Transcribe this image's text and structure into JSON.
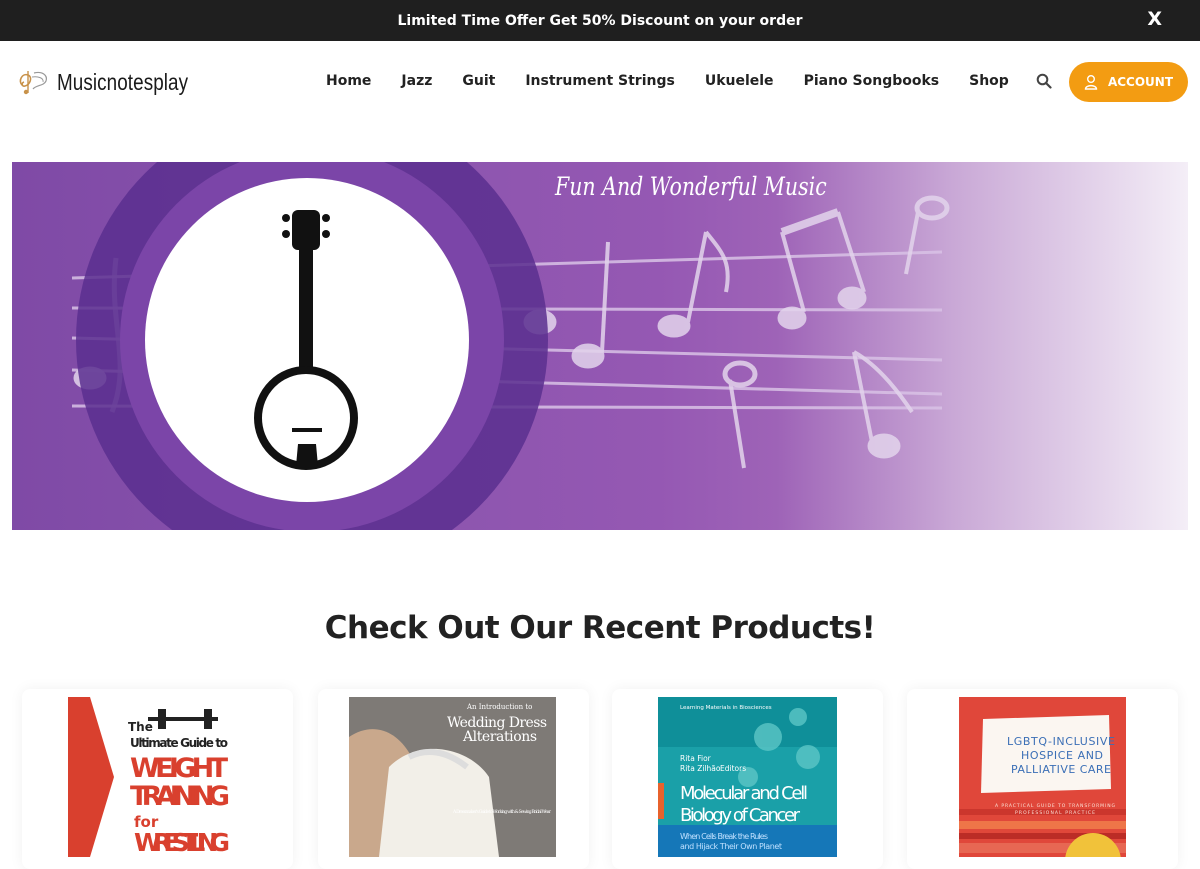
{
  "promo": {
    "text": "Limited Time Offer Get 50% Discount on your order",
    "close_label": "X"
  },
  "header": {
    "logo_text": "Musicnotesplay",
    "nav": [
      "Home",
      "Jazz",
      "Guit",
      "Instrument Strings",
      "Ukuelele",
      "Piano Songbooks",
      "Shop"
    ],
    "icons": [
      "search-icon",
      "cart-icon"
    ],
    "account_label": "ACCOUNT",
    "accent_color": "#f39c12"
  },
  "banner": {
    "title": "Fun And Wonderful Music"
  },
  "products_section": {
    "title": "Check Out Our Recent Products!",
    "products": [
      {
        "cover": {
          "line1": "The",
          "line2": "Ultimate Guide to",
          "line3": "WEIGHT",
          "line4": "TRAINING",
          "line5": "for",
          "line6": "WRESTLING"
        }
      },
      {
        "cover": {
          "subtitle": "An Introduction to",
          "title1": "Wedding Dress",
          "title2": "Alterations",
          "tagline": "A Dressmaker's Guide to Working with & Sewing Bridal Wear"
        }
      },
      {
        "cover": {
          "series": "Learning Materials in Biosciences",
          "editor1": "Rita Fior",
          "editor2": "Rita Zilhão",
          "editors_label": "Editors",
          "title1": "Molecular and Cell",
          "title2": "Biology of Cancer",
          "subtitle1": "When Cells Break the Rules",
          "subtitle2": "and Hijack Their Own Planet"
        }
      },
      {
        "cover": {
          "title1": "LGBTQ-INCLUSIVE",
          "title2": "HOSPICE AND",
          "title3": "PALLIATIVE CARE",
          "tagline1": "A PRACTICAL GUIDE TO TRANSFORMING",
          "tagline2": "PROFESSIONAL PRACTICE"
        }
      }
    ]
  }
}
